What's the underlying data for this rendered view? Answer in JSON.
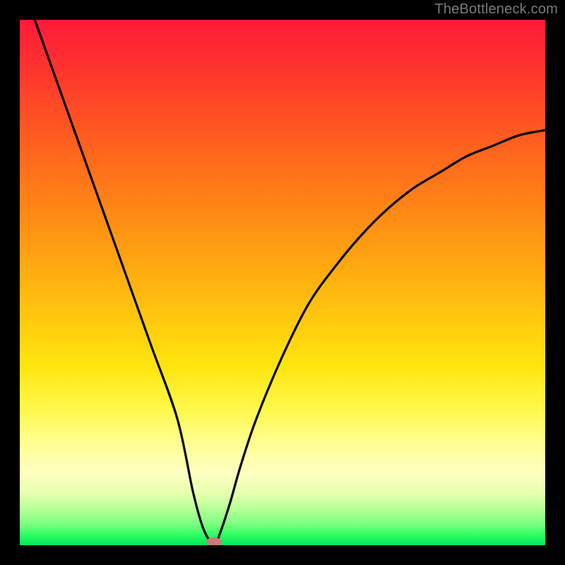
{
  "attribution": "TheBottleneck.com",
  "colors": {
    "frame": "#000000",
    "curve": "#000000",
    "marker": "#cc7a7a",
    "gradient_top": "#ff1a3a",
    "gradient_bottom": "#00e85a"
  },
  "chart_data": {
    "type": "line",
    "title": "",
    "xlabel": "",
    "ylabel": "",
    "xlim": [
      0,
      100
    ],
    "ylim": [
      0,
      100
    ],
    "grid": false,
    "legend": false,
    "series": [
      {
        "name": "bottleneck-curve",
        "x": [
          0,
          5,
          10,
          15,
          20,
          25,
          30,
          33,
          35,
          37,
          38,
          40,
          42,
          45,
          50,
          55,
          60,
          65,
          70,
          75,
          80,
          85,
          90,
          95,
          100
        ],
        "values": [
          108,
          94,
          80,
          66,
          52,
          38,
          24,
          10,
          3,
          0,
          2,
          8,
          15,
          24,
          36,
          46,
          53,
          59,
          64,
          68,
          71,
          74,
          76,
          78,
          79
        ]
      }
    ],
    "annotations": [
      {
        "name": "optimal-point",
        "x": 37,
        "y": 0
      }
    ],
    "notes": "y-axis encodes bottleneck severity mapped to background color: 0 = green (no bottleneck), 100 = red (severe)."
  }
}
